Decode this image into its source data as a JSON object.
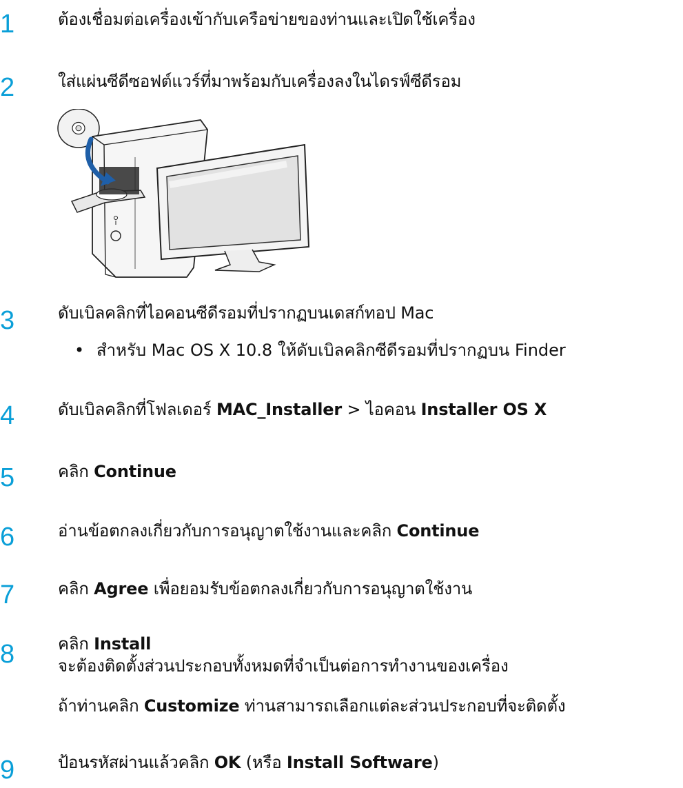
{
  "steps": [
    {
      "number": "1",
      "text": "ต้องเชื่อมต่อเครื่องเข้ากับเครือข่ายของท่านและเปิดใช้เครื่อง"
    },
    {
      "number": "2",
      "text": "ใส่แผ่นซีดีซอฟต์แวร์ที่มาพร้อมกับเครื่องลงในไดรฟ์ซีดีรอม"
    },
    {
      "number": "3",
      "text": "ดับเบิลคลิกที่ไอคอนซีดีรอมที่ปรากฏบนเดสก์ทอป Mac",
      "bullet": "สำหรับ Mac OS X 10.8 ให้ดับเบิลคลิกซีดีรอมที่ปรากฏบน Finder",
      "bullet_symbol": "•"
    },
    {
      "number": "4",
      "text_a": "ดับเบิลคลิกที่โฟลเดอร์ ",
      "bold_a": "MAC_Installer",
      "text_b": " > ไอคอน ",
      "bold_b": "Installer OS X"
    },
    {
      "number": "5",
      "text_a": "คลิก ",
      "bold_a": "Continue"
    },
    {
      "number": "6",
      "text_a": "อ่านข้อตกลงเกี่ยวกับการอนุญาตใช้งานและคลิก ",
      "bold_a": "Continue"
    },
    {
      "number": "7",
      "text_a": "คลิก ",
      "bold_a": "Agree",
      "text_b": " เพื่อยอมรับข้อตกลงเกี่ยวกับการอนุญาตใช้งาน"
    },
    {
      "number": "8",
      "text_a": "คลิก ",
      "bold_a": "Install",
      "line2": "จะต้องติดตั้งส่วนประกอบทั้งหมดที่จำเป็นต่อการทำงานของเครื่อง",
      "line3_a": "ถ้าท่านคลิก ",
      "line3_bold": "Customize",
      "line3_b": " ท่านสามารถเลือกแต่ละส่วนประกอบที่จะติดตั้ง"
    },
    {
      "number": "9",
      "text_a": "ป้อนรหัสผ่านแล้วคลิก ",
      "bold_a": "OK",
      "text_b": " (หรือ ",
      "bold_b": "Install Software",
      "text_c": ")"
    }
  ],
  "colors": {
    "step_number": "#0a9fd8",
    "text": "#111111"
  },
  "illustration": {
    "name": "insert-cd-into-mac-illustration"
  }
}
